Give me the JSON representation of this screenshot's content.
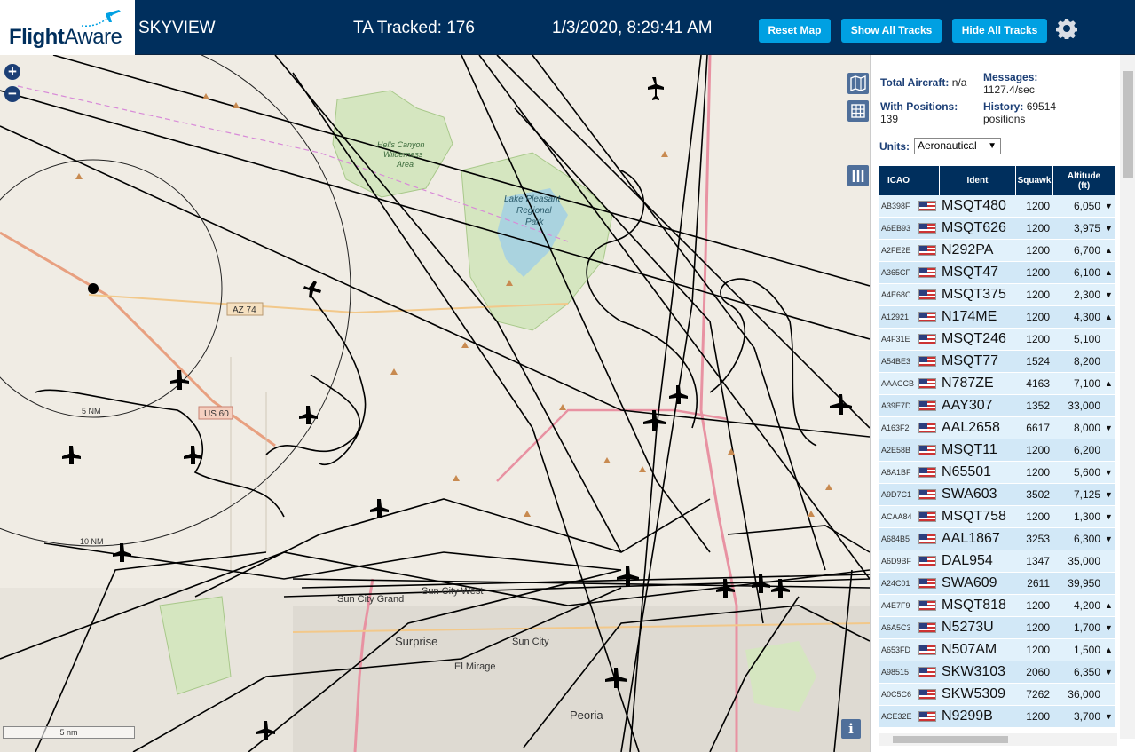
{
  "header": {
    "logo_flight": "Flight",
    "logo_aware": "Aware",
    "app_title": "SKYVIEW",
    "ta_tracked": "TA Tracked: 176",
    "clock": "1/3/2020, 8:29:41 AM",
    "reset_map": "Reset Map",
    "show_all_tracks": "Show All Tracks",
    "hide_all_tracks": "Hide All Tracks",
    "settings_icon": "gear-icon"
  },
  "map": {
    "zoom_in": "+",
    "zoom_out": "−",
    "scale_label": "5 nm",
    "info": "i",
    "ring_labels": [
      "5 NM",
      "10 NM"
    ],
    "place_labels": [
      "Hells Canyon",
      "Wilderness",
      "Area",
      "Lake Pleasant",
      "Regional",
      "Park",
      "AZ 74",
      "US 60",
      "Sun City West",
      "Sun City Grand",
      "Surprise",
      "Sun City",
      "El Mirage",
      "Peoria"
    ],
    "colors": {
      "land": "#f0ece4",
      "water": "#aad3df",
      "park": "#c8dfa8",
      "highway": "#e892a2",
      "track": "#000000"
    }
  },
  "stats": {
    "total_aircraft_label": "Total Aircraft:",
    "total_aircraft_value": "n/a",
    "messages_label": "Messages:",
    "messages_value": "1127.4/sec",
    "with_positions_label": "With Positions:",
    "with_positions_value": "139",
    "history_label": "History:",
    "history_value": "69514",
    "history_unit": "positions"
  },
  "units": {
    "label": "Units:",
    "selected": "Aeronautical"
  },
  "table": {
    "headers": {
      "icao": "ICAO",
      "ident": "Ident",
      "squawk": "Squawk",
      "altitude": "Altitude\n(ft)"
    },
    "rows": [
      {
        "icao": "AB398F",
        "ident": "MSQT480",
        "squawk": "1200",
        "alt": "6,050",
        "trend": "▼"
      },
      {
        "icao": "A6EB93",
        "ident": "MSQT626",
        "squawk": "1200",
        "alt": "3,975",
        "trend": "▼"
      },
      {
        "icao": "A2FE2E",
        "ident": "N292PA",
        "squawk": "1200",
        "alt": "6,700",
        "trend": "▲"
      },
      {
        "icao": "A365CF",
        "ident": "MSQT47",
        "squawk": "1200",
        "alt": "6,100",
        "trend": "▲"
      },
      {
        "icao": "A4E68C",
        "ident": "MSQT375",
        "squawk": "1200",
        "alt": "2,300",
        "trend": "▼"
      },
      {
        "icao": "A12921",
        "ident": "N174ME",
        "squawk": "1200",
        "alt": "4,300",
        "trend": "▲"
      },
      {
        "icao": "A4F31E",
        "ident": "MSQT246",
        "squawk": "1200",
        "alt": "5,100",
        "trend": ""
      },
      {
        "icao": "A54BE3",
        "ident": "MSQT77",
        "squawk": "1524",
        "alt": "8,200",
        "trend": ""
      },
      {
        "icao": "AAACCB",
        "ident": "N787ZE",
        "squawk": "4163",
        "alt": "7,100",
        "trend": "▲"
      },
      {
        "icao": "A39E7D",
        "ident": "AAY307",
        "squawk": "1352",
        "alt": "33,000",
        "trend": ""
      },
      {
        "icao": "A163F2",
        "ident": "AAL2658",
        "squawk": "6617",
        "alt": "8,000",
        "trend": "▼"
      },
      {
        "icao": "A2E58B",
        "ident": "MSQT11",
        "squawk": "1200",
        "alt": "6,200",
        "trend": ""
      },
      {
        "icao": "A8A1BF",
        "ident": "N65501",
        "squawk": "1200",
        "alt": "5,600",
        "trend": "▼"
      },
      {
        "icao": "A9D7C1",
        "ident": "SWA603",
        "squawk": "3502",
        "alt": "7,125",
        "trend": "▼"
      },
      {
        "icao": "ACAA84",
        "ident": "MSQT758",
        "squawk": "1200",
        "alt": "1,300",
        "trend": "▼"
      },
      {
        "icao": "A684B5",
        "ident": "AAL1867",
        "squawk": "3253",
        "alt": "6,300",
        "trend": "▼"
      },
      {
        "icao": "A6D9BF",
        "ident": "DAL954",
        "squawk": "1347",
        "alt": "35,000",
        "trend": ""
      },
      {
        "icao": "A24C01",
        "ident": "SWA609",
        "squawk": "2611",
        "alt": "39,950",
        "trend": ""
      },
      {
        "icao": "A4E7F9",
        "ident": "MSQT818",
        "squawk": "1200",
        "alt": "4,200",
        "trend": "▲"
      },
      {
        "icao": "A6A5C3",
        "ident": "N5273U",
        "squawk": "1200",
        "alt": "1,700",
        "trend": "▼"
      },
      {
        "icao": "A653FD",
        "ident": "N507AM",
        "squawk": "1200",
        "alt": "1,500",
        "trend": "▲"
      },
      {
        "icao": "A98515",
        "ident": "SKW3103",
        "squawk": "2060",
        "alt": "6,350",
        "trend": "▼"
      },
      {
        "icao": "A0C5C6",
        "ident": "SKW5309",
        "squawk": "7262",
        "alt": "36,000",
        "trend": ""
      },
      {
        "icao": "ACE32E",
        "ident": "N9299B",
        "squawk": "1200",
        "alt": "3,700",
        "trend": "▼"
      }
    ]
  }
}
